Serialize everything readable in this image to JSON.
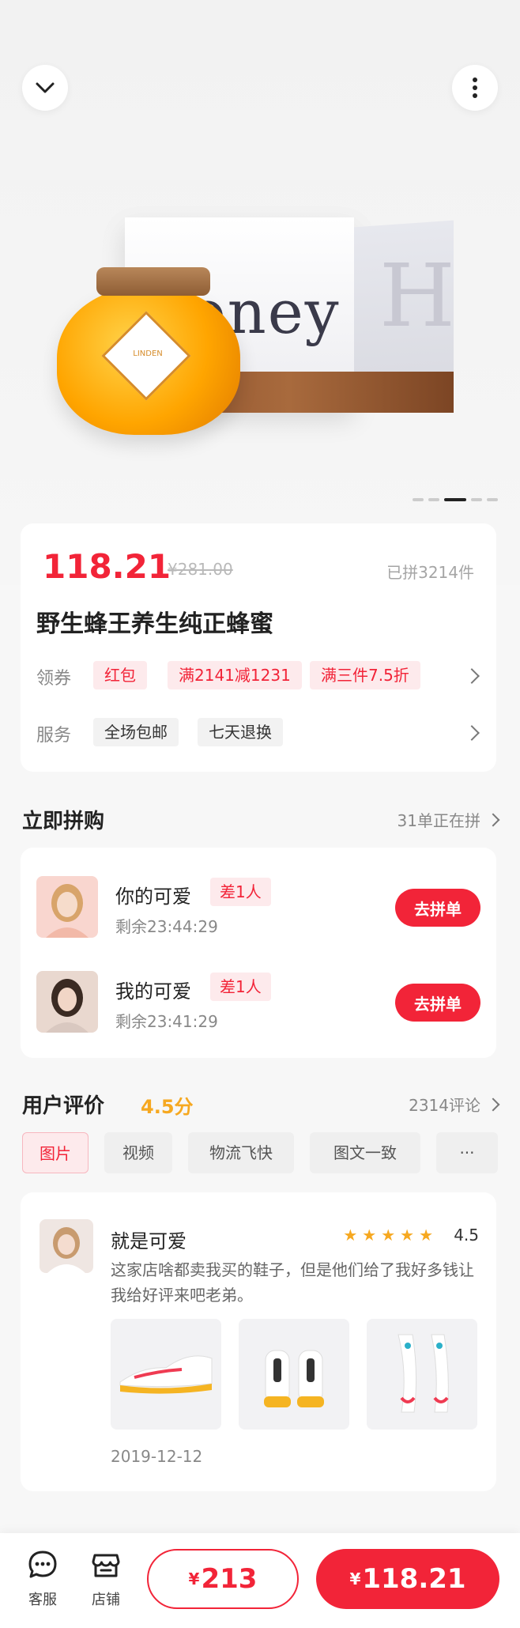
{
  "product": {
    "price": "118.21",
    "original_price": "¥281.00",
    "sold": "已拼3214件",
    "title": "野生蜂王养生纯正蜂蜜"
  },
  "coupon": {
    "label": "领券",
    "tags": [
      "红包",
      "满2141减1231",
      "满三件7.5折"
    ]
  },
  "service": {
    "label": "服务",
    "tags": [
      "全场包邮",
      "七天退换"
    ]
  },
  "group_buy": {
    "title": "立即拼购",
    "more": "31单正在拼",
    "rows": [
      {
        "name": "你的可爱",
        "badge": "差1人",
        "time": "剩余23:44:29",
        "button": "去拼单"
      },
      {
        "name": "我的可爱",
        "badge": "差1人",
        "time": "剩余23:41:29",
        "button": "去拼单"
      }
    ]
  },
  "reviews": {
    "title": "用户评价",
    "score": "4.5分",
    "count": "2314评论",
    "filters": [
      "图片",
      "视频",
      "物流飞快",
      "图文一致",
      "···"
    ],
    "item": {
      "name": "就是可爱",
      "rating": "4.5",
      "text": "这家店啥都卖我买的鞋子，但是他们给了我好多钱让我给好评来吧老弟。",
      "date": "2019-12-12"
    }
  },
  "hero_art": {
    "box_text": "oney",
    "box_letter": "H",
    "jar_label": "LINDEN"
  },
  "bottom_bar": {
    "service": "客服",
    "store": "店铺",
    "yen": "¥",
    "group_price": "213",
    "single_price": "118.21"
  },
  "colors": {
    "accent": "#f22438",
    "star": "#f6a820"
  }
}
